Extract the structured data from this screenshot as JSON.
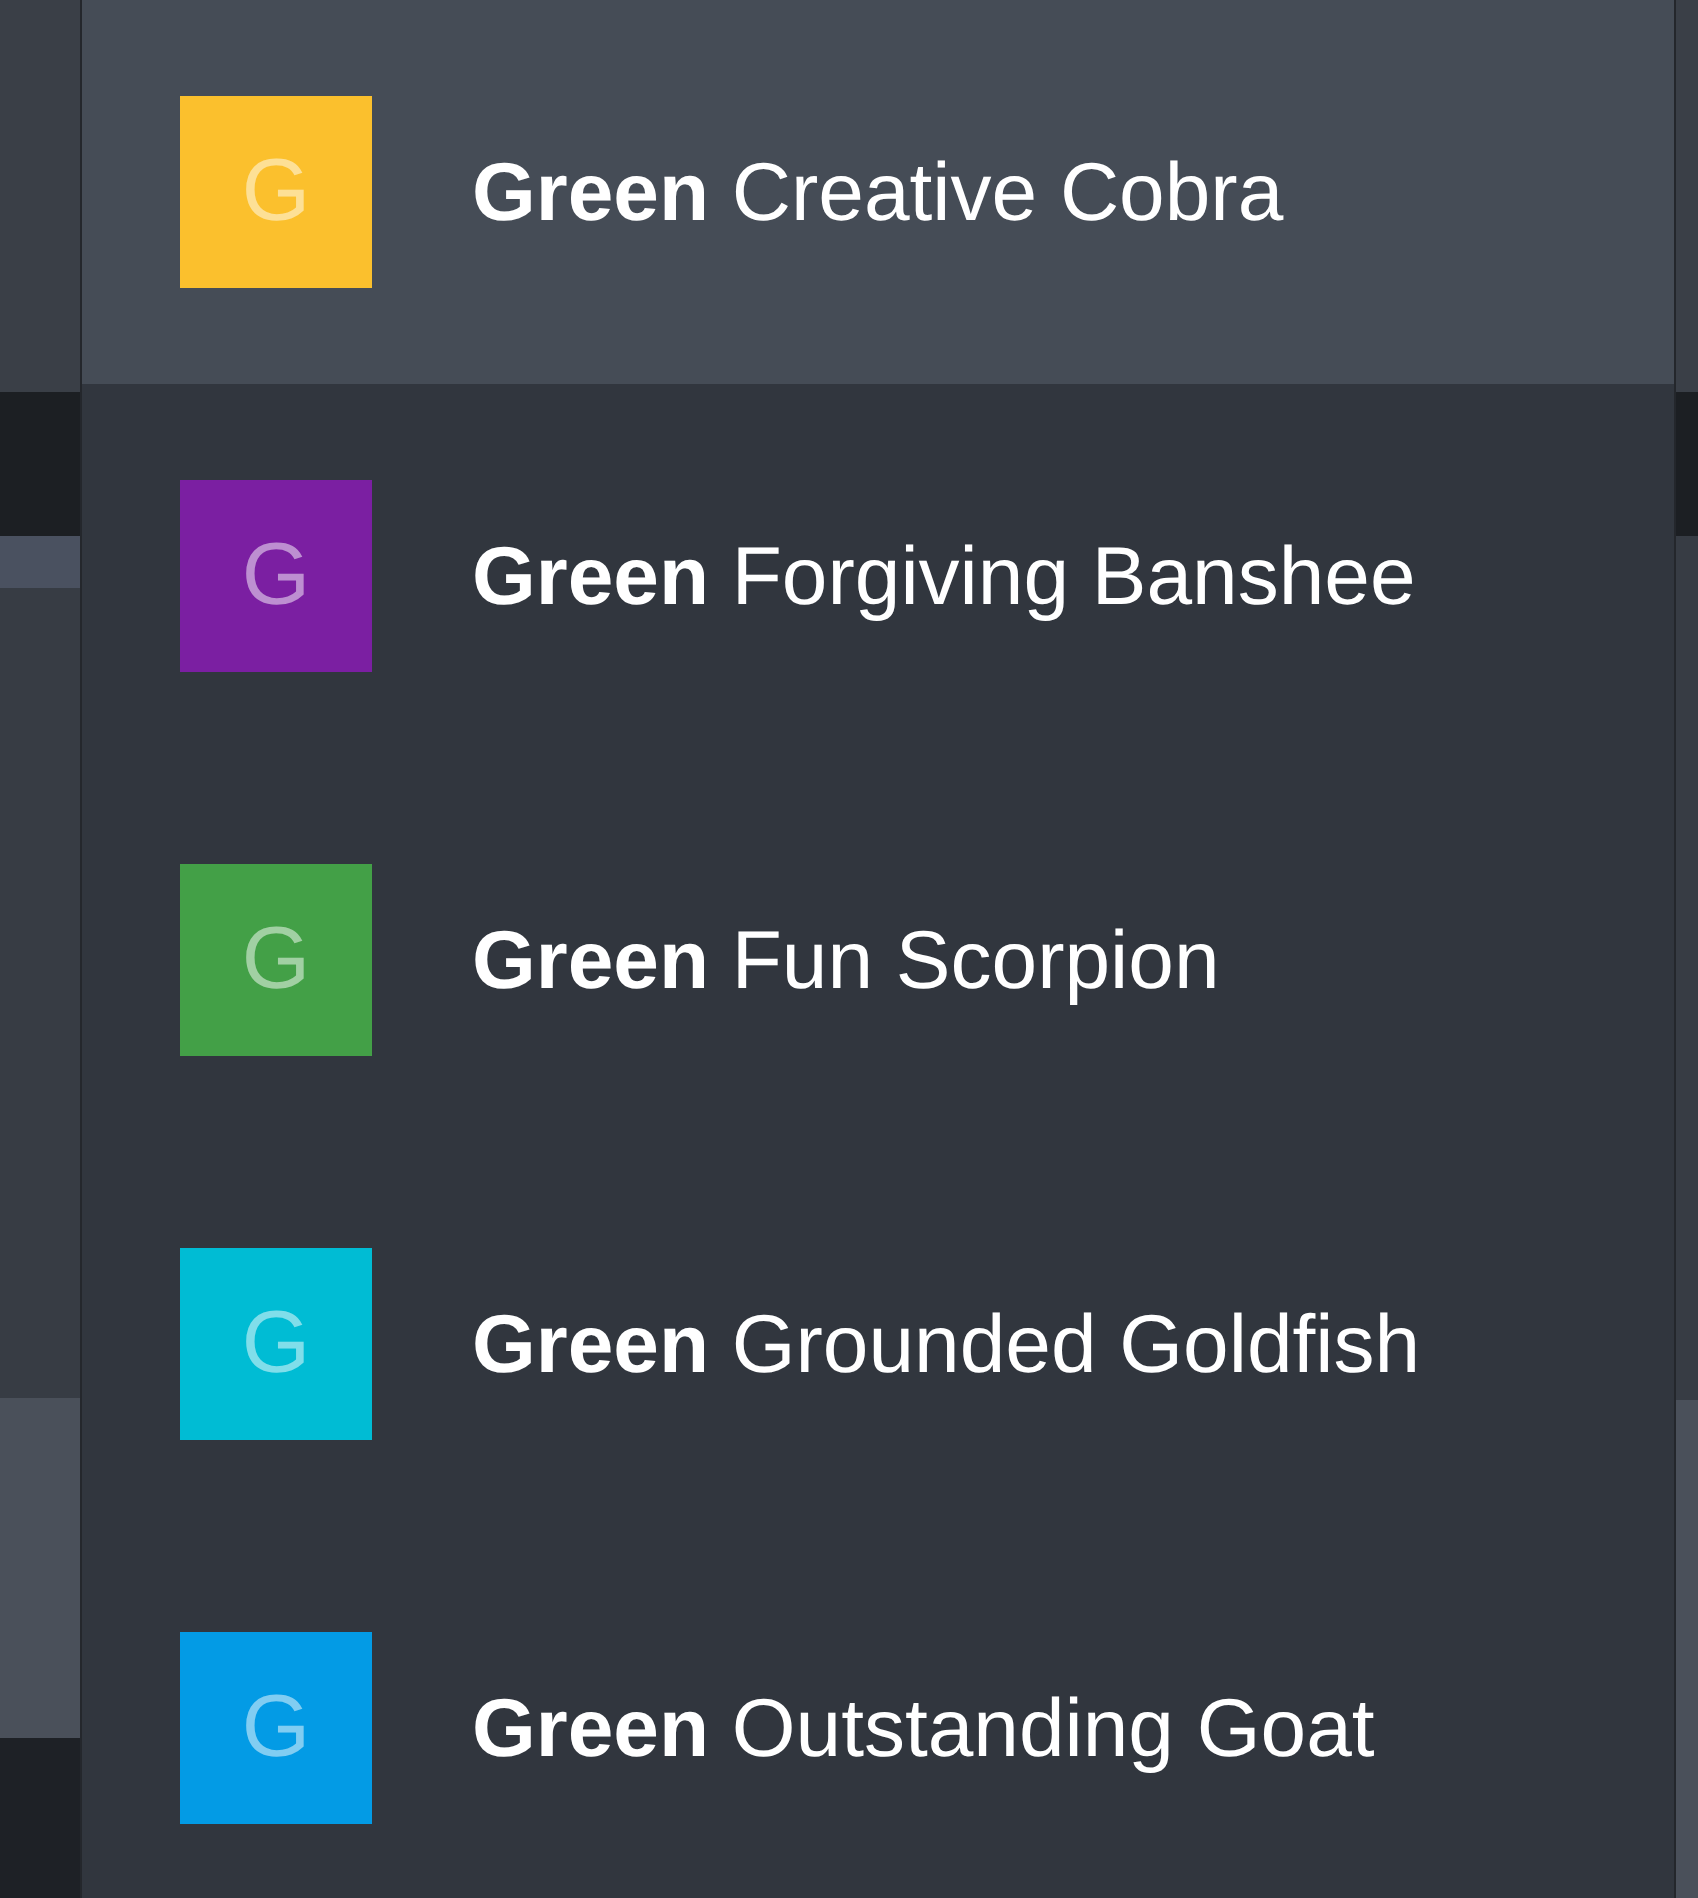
{
  "menu": {
    "items": [
      {
        "avatar_letter": "G",
        "label": "**Green** Creative Cobra",
        "color": "#fbc02d",
        "selected": true
      },
      {
        "avatar_letter": "G",
        "label": "**Green** Forgiving Banshee",
        "color": "#7b1fa2",
        "selected": false
      },
      {
        "avatar_letter": "G",
        "label": "**Green** Fun Scorpion",
        "color": "#43a047",
        "selected": false
      },
      {
        "avatar_letter": "G",
        "label": "**Green** Grounded Goldfish",
        "color": "#00bcd4",
        "selected": false
      },
      {
        "avatar_letter": "G",
        "label": "**Green** Outstanding Goat",
        "color": "#039be5",
        "selected": false
      }
    ]
  }
}
